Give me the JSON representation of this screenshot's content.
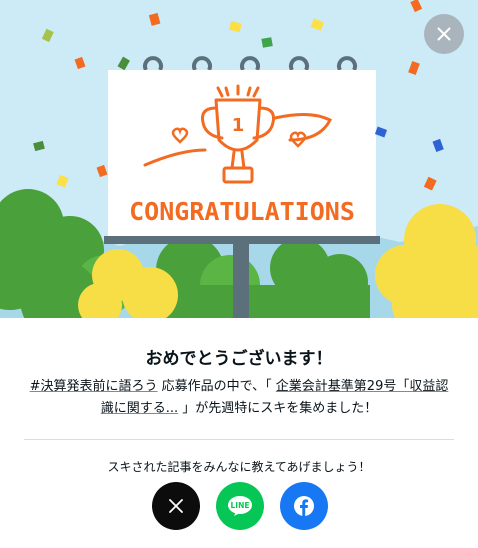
{
  "dialog": {
    "title": "おめでとうございます！",
    "message": {
      "hashtag": "#決算発表前に語ろう",
      "part1": " 応募作品の中で、「 ",
      "article_title": "企業会計基準第29号「収益認識に関する...",
      "part2": " 」が先週特にスキを集めました！"
    },
    "share_prompt": "スキされた記事をみんなに教えてあげましょう！",
    "share_buttons": [
      {
        "network": "X",
        "icon": "x-logo-icon",
        "color": "#0c0c0c"
      },
      {
        "network": "LINE",
        "icon": "line-logo-icon",
        "color": "#06c755",
        "label": "LINE"
      },
      {
        "network": "Facebook",
        "icon": "facebook-logo-icon",
        "color": "#1877f2"
      }
    ]
  },
  "illustration": {
    "billboard_text": "CONGRATULATIONS",
    "trophy_rank": "1",
    "accent_color": "#f26b21"
  },
  "close_icon": "close-icon"
}
